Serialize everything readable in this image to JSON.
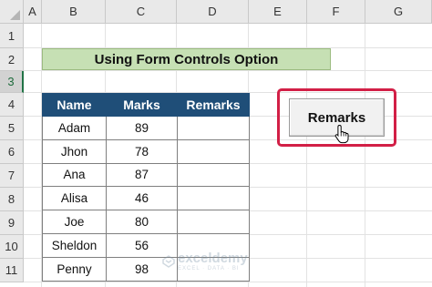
{
  "columns": [
    "A",
    "B",
    "C",
    "D",
    "E",
    "F",
    "G"
  ],
  "rows": [
    "1",
    "2",
    "3",
    "4",
    "5",
    "6",
    "7",
    "8",
    "9",
    "10",
    "11"
  ],
  "title": "Using Form Controls Option",
  "table": {
    "headers": [
      "Name",
      "Marks",
      "Remarks"
    ],
    "rows": [
      {
        "name": "Adam",
        "marks": "89",
        "remarks": ""
      },
      {
        "name": "Jhon",
        "marks": "78",
        "remarks": ""
      },
      {
        "name": "Ana",
        "marks": "87",
        "remarks": ""
      },
      {
        "name": "Alisa",
        "marks": "46",
        "remarks": ""
      },
      {
        "name": "Joe",
        "marks": "80",
        "remarks": ""
      },
      {
        "name": "Sheldon",
        "marks": "56",
        "remarks": ""
      },
      {
        "name": "Penny",
        "marks": "98",
        "remarks": ""
      }
    ]
  },
  "form_button": {
    "label": "Remarks"
  },
  "selected_row": "3",
  "watermark": {
    "brand": "exceldemy",
    "tagline": "EXCEL · DATA · BI"
  },
  "colors": {
    "header_fill": "#1f4e78",
    "title_fill": "#c6e0b4",
    "highlight_frame": "#d21f46"
  }
}
